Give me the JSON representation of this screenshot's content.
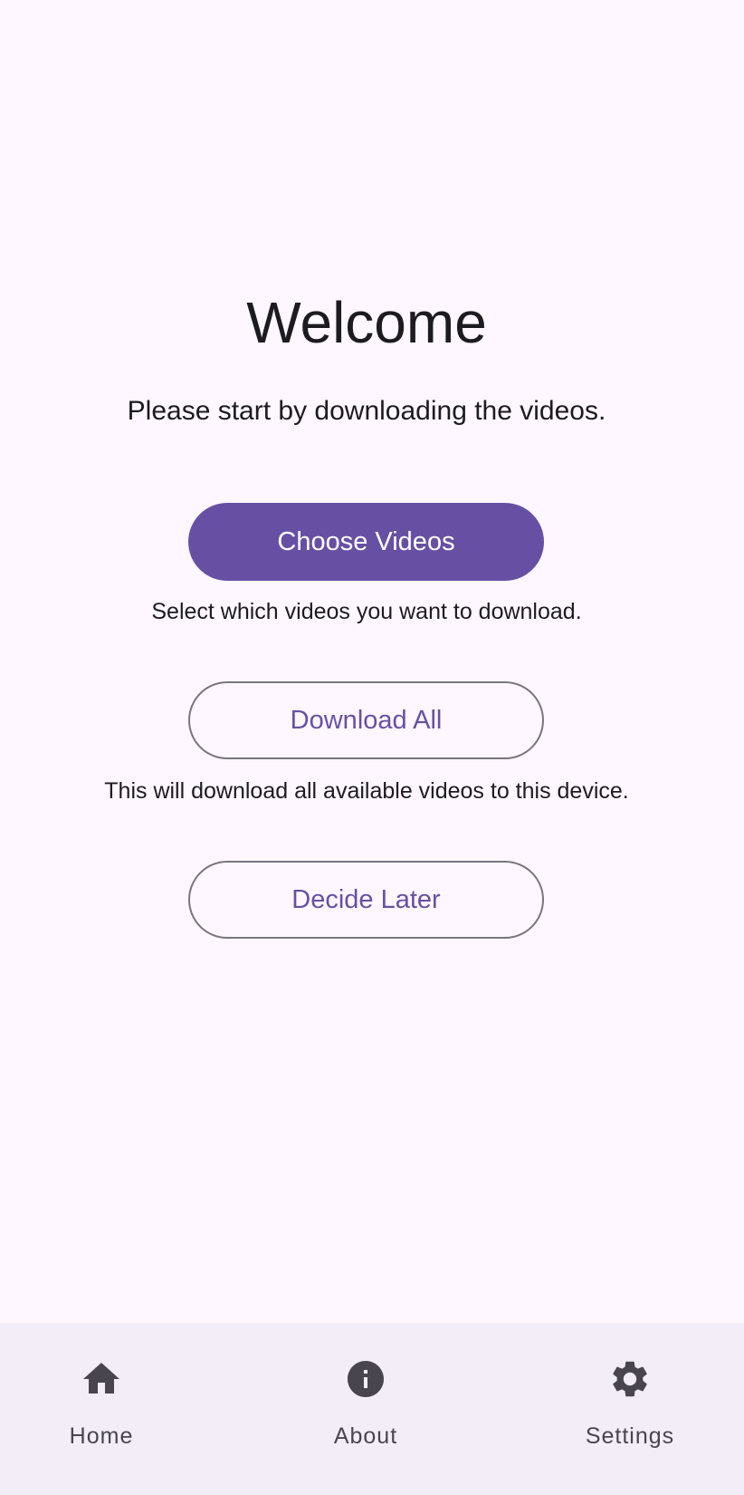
{
  "welcome": {
    "title": "Welcome",
    "subtitle": "Please start by downloading the videos."
  },
  "actions": {
    "choose_label": "Choose Videos",
    "choose_hint": "Select which videos you want to download.",
    "download_label": "Download All",
    "download_hint": "This will download all available videos to this device.",
    "later_label": "Decide Later"
  },
  "nav": {
    "items": [
      {
        "label": "Home",
        "icon": "home-icon"
      },
      {
        "label": "About",
        "icon": "info-icon"
      },
      {
        "label": "Settings",
        "icon": "gear-icon"
      }
    ]
  },
  "colors": {
    "primary": "#6750A4",
    "background": "#FEF7FF",
    "nav_background": "#F3EDF7",
    "outline": "#79747E",
    "icon": "#49454F"
  }
}
